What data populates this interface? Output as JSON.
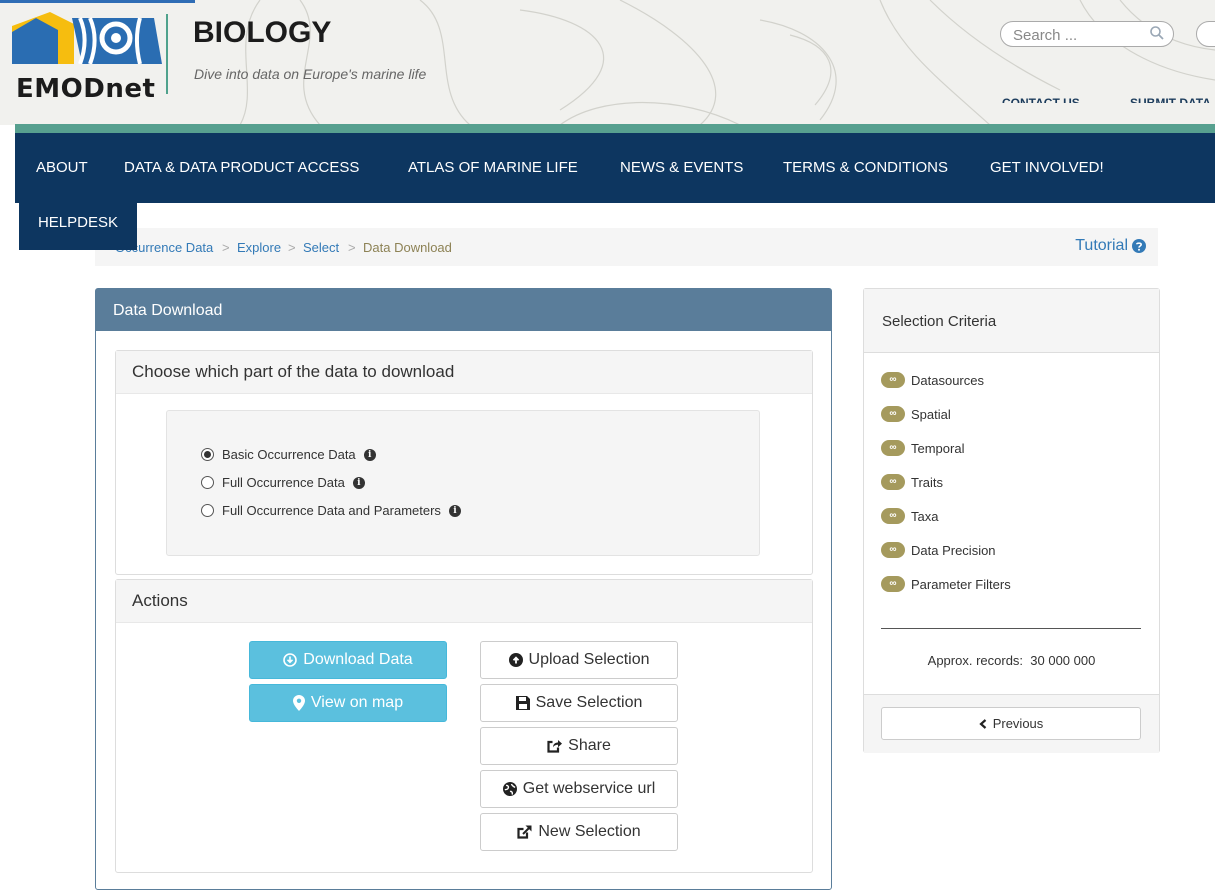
{
  "header": {
    "logo_text": "EMODnet",
    "title": "BIOLOGY",
    "tagline": "Dive into data on Europe's marine life",
    "search_placeholder": "Search ...",
    "contact_label": "CONTACT US",
    "submit_label": "SUBMIT DATA"
  },
  "nav": {
    "items": [
      "ABOUT",
      "DATA & DATA PRODUCT ACCESS",
      "ATLAS OF MARINE LIFE",
      "NEWS & EVENTS",
      "TERMS & CONDITIONS",
      "GET INVOLVED!",
      "HELPDESK"
    ]
  },
  "breadcrumb": {
    "items": [
      "Occurrence Data",
      "Explore",
      "Select",
      "Data Download"
    ],
    "separator": ">",
    "tutorial_label": "Tutorial"
  },
  "main": {
    "heading": "Data Download",
    "choose_panel": {
      "heading": "Choose which part of the data to download",
      "options": [
        {
          "label": "Basic Occurrence Data",
          "selected": true
        },
        {
          "label": "Full Occurrence Data",
          "selected": false
        },
        {
          "label": "Full Occurrence Data and Parameters",
          "selected": false
        }
      ]
    },
    "actions_panel": {
      "heading": "Actions",
      "download_label": "Download Data",
      "view_map_label": "View on map",
      "upload_label": "Upload Selection",
      "save_label": "Save Selection",
      "share_label": "Share",
      "webservice_label": "Get webservice url",
      "new_selection_label": "New Selection"
    }
  },
  "sidebar": {
    "heading": "Selection Criteria",
    "badge_symbol": "∞",
    "criteria": [
      "Datasources",
      "Spatial",
      "Temporal",
      "Traits",
      "Taxa",
      "Data Precision",
      "Parameter Filters"
    ],
    "approx_records_label": "Approx. records:",
    "approx_records_value": "30 000 000",
    "previous_label": "Previous"
  },
  "colors": {
    "nav_bg": "#0d3660",
    "accent_green": "#57a08f",
    "panel_heading": "#5a7d9a",
    "button_info": "#5bc0de",
    "badge": "#a59a5d",
    "breadcrumb_active": "#8d8255",
    "link": "#337ab7"
  }
}
